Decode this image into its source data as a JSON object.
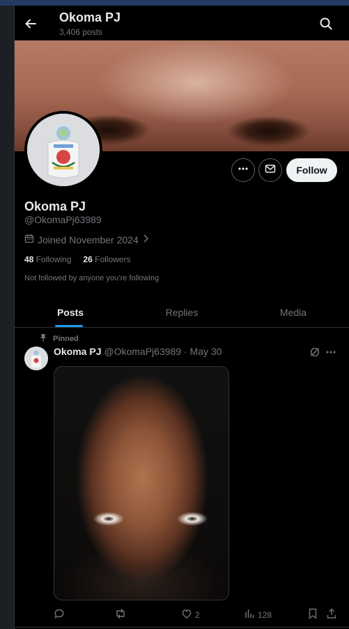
{
  "header": {
    "title": "Okoma PJ",
    "post_count": "3,406 posts"
  },
  "profile": {
    "name": "Okoma PJ",
    "handle": "@OkomaPj63989",
    "joined": "Joined November 2024",
    "following_count": "48",
    "following_label": "Following",
    "followers_count": "26",
    "followers_label": "Followers",
    "not_followed_text": "Not followed by anyone you’re following"
  },
  "actions": {
    "follow_label": "Follow"
  },
  "tabs": [
    {
      "label": "Posts",
      "active": true
    },
    {
      "label": "Replies",
      "active": false
    },
    {
      "label": "Media",
      "active": false
    }
  ],
  "post": {
    "pinned_label": "Pinned",
    "author_name": "Okoma PJ",
    "author_handle": "@OkomaPj63989",
    "date": "· May 30",
    "likes": "2",
    "views": "128"
  },
  "icons": {
    "back": "arrow-left-icon",
    "search": "search-icon",
    "more": "more-dots-icon",
    "message": "envelope-icon",
    "calendar": "calendar-icon",
    "chevron": "chevron-right-icon",
    "pin": "pin-icon",
    "grok": "grok-icon",
    "reply": "reply-icon",
    "repost": "repost-icon",
    "like": "heart-icon",
    "views": "bar-chart-icon",
    "bookmark": "bookmark-icon",
    "share": "share-icon"
  },
  "colors": {
    "accent": "#1d9bf0",
    "background": "#000000",
    "muted": "#71767b",
    "text": "#e7e9ea"
  }
}
